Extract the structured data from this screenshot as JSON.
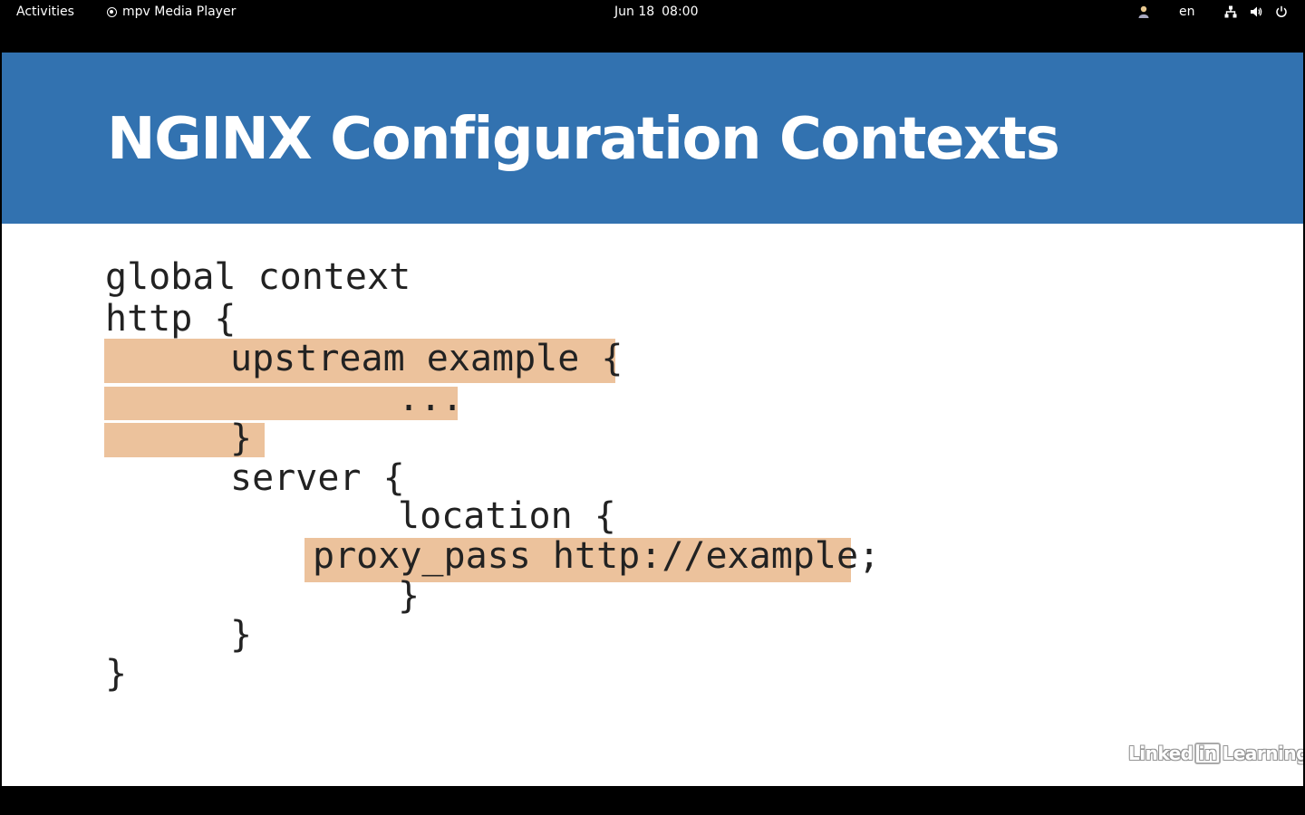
{
  "topbar": {
    "activities": "Activities",
    "app_name": "mpv Media Player",
    "date": "Jun 18",
    "time": "08:00",
    "language": "en"
  },
  "slide": {
    "title": "NGINX Configuration Contexts",
    "code_lines": [
      "global context",
      "http {",
      "upstream example {",
      "...",
      "}",
      "server {",
      "location {",
      "proxy_pass http://example;",
      "}",
      "}",
      "}"
    ],
    "colors": {
      "banner": "#3272b0",
      "highlight": "#ecc29c",
      "text": "#222222"
    }
  },
  "watermark": {
    "part1": "Linked",
    "part2": "in",
    "part3": "Learning"
  }
}
